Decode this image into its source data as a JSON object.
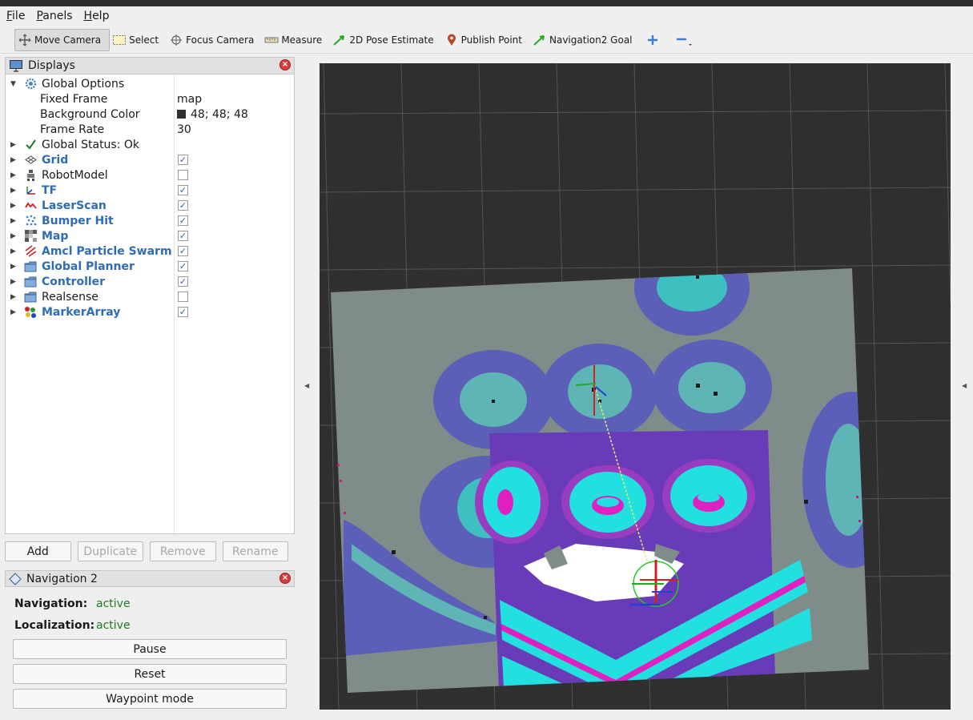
{
  "menubar": {
    "items": [
      {
        "key": "F",
        "rest": "ile"
      },
      {
        "key": "P",
        "rest": "anels"
      },
      {
        "key": "H",
        "rest": "elp"
      }
    ]
  },
  "toolbar": {
    "tools": [
      {
        "label": "Move Camera",
        "icon": "move-camera-icon",
        "active": true
      },
      {
        "label": "Select",
        "icon": "select-icon"
      },
      {
        "label": "Focus Camera",
        "icon": "focus-camera-icon"
      },
      {
        "label": "Measure",
        "icon": "measure-icon"
      },
      {
        "label": "2D Pose Estimate",
        "icon": "pose-estimate-icon"
      },
      {
        "label": "Publish Point",
        "icon": "publish-point-icon"
      },
      {
        "label": "Navigation2 Goal",
        "icon": "nav2-goal-icon"
      }
    ],
    "extra_icons": [
      "add-tool-icon",
      "remove-tool-icon"
    ]
  },
  "displays": {
    "title": "Displays",
    "global_options": {
      "label": "Global Options",
      "fixed_frame_label": "Fixed Frame",
      "fixed_frame_value": "map",
      "bg_color_label": "Background Color",
      "bg_color_value": "48; 48; 48",
      "bg_color_hex": "#303030",
      "frame_rate_label": "Frame Rate",
      "frame_rate_value": "30"
    },
    "global_status": "Global Status: Ok",
    "items": [
      {
        "label": "Grid",
        "checked": true,
        "icon": "grid-icon"
      },
      {
        "label": "RobotModel",
        "checked": false,
        "icon": "robot-model-icon"
      },
      {
        "label": "TF",
        "checked": true,
        "icon": "tf-icon"
      },
      {
        "label": "LaserScan",
        "checked": true,
        "icon": "laserscan-icon"
      },
      {
        "label": "Bumper Hit",
        "checked": true,
        "icon": "bumper-hit-icon"
      },
      {
        "label": "Map",
        "checked": true,
        "icon": "map-icon"
      },
      {
        "label": "Amcl Particle Swarm",
        "checked": true,
        "icon": "particle-swarm-icon"
      },
      {
        "label": "Global Planner",
        "checked": true,
        "icon": "folder-icon"
      },
      {
        "label": "Controller",
        "checked": true,
        "icon": "folder-icon"
      },
      {
        "label": "Realsense",
        "checked": false,
        "icon": "folder-icon"
      },
      {
        "label": "MarkerArray",
        "checked": true,
        "icon": "marker-array-icon"
      }
    ],
    "buttons": {
      "add": "Add",
      "duplicate": "Duplicate",
      "remove": "Remove",
      "rename": "Rename"
    }
  },
  "navigation_panel": {
    "title": "Navigation 2",
    "navigation_label": "Navigation:",
    "navigation_status": "active",
    "localization_label": "Localization:",
    "localization_status": "active",
    "pause": "Pause",
    "reset": "Reset",
    "waypoint": "Waypoint mode"
  },
  "colors": {
    "accent_blue": "#2e6db6",
    "status_green": "#1d7a1d",
    "viewport_bg": "#303030",
    "map_free": "#7f8c8a",
    "costmap_cyan": "#22e0e0",
    "costmap_magenta": "#e020c0",
    "costmap_purple": "#6a3bb8"
  }
}
